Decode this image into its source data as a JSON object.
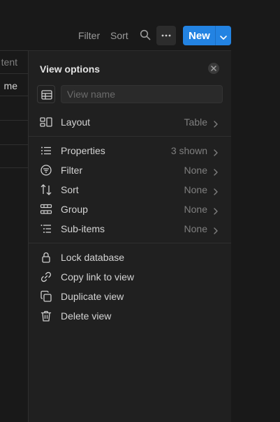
{
  "toolbar": {
    "filter_label": "Filter",
    "sort_label": "Sort",
    "search_icon": "search-icon",
    "more_icon": "more-horizontal-icon",
    "new_label": "New",
    "new_dropdown_icon": "chevron-down-icon",
    "accent_color": "#2383e2"
  },
  "table": {
    "header_cell": "tent",
    "row_cells": [
      "me"
    ]
  },
  "panel": {
    "title": "View options",
    "close_icon": "close-icon",
    "view_name": {
      "value": "",
      "placeholder": "View name",
      "icon": "table-icon"
    },
    "layout": {
      "label": "Layout",
      "value": "Table",
      "icon": "layout-icon"
    },
    "settings": [
      {
        "label": "Properties",
        "value": "3 shown",
        "icon": "list-icon"
      },
      {
        "label": "Filter",
        "value": "None",
        "icon": "filter-icon"
      },
      {
        "label": "Sort",
        "value": "None",
        "icon": "sort-icon"
      },
      {
        "label": "Group",
        "value": "None",
        "icon": "group-icon"
      },
      {
        "label": "Sub-items",
        "value": "None",
        "icon": "sub-items-icon"
      }
    ],
    "actions": [
      {
        "label": "Lock database",
        "icon": "lock-icon"
      },
      {
        "label": "Copy link to view",
        "icon": "link-icon"
      },
      {
        "label": "Duplicate view",
        "icon": "duplicate-icon"
      },
      {
        "label": "Delete view",
        "icon": "trash-icon"
      }
    ]
  }
}
